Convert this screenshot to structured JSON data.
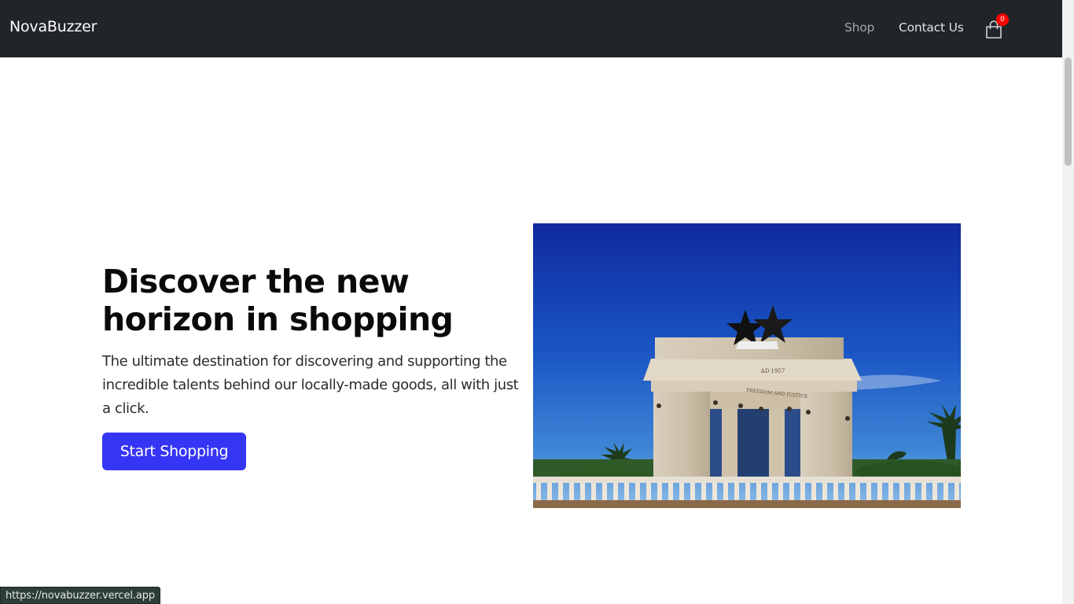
{
  "navbar": {
    "brand": "NovaBuzzer",
    "links": [
      {
        "label": "Shop"
      },
      {
        "label": "Contact Us"
      }
    ],
    "cart_count": "0",
    "cart_icon": "shopping-bag-icon"
  },
  "hero": {
    "title": "Discover the new horizon in shopping",
    "description": "The ultimate destination for discovering and supporting the incredible talents behind our locally-made goods, all with just a click.",
    "cta_label": "Start Shopping",
    "image_alt": "Independence Arch monument",
    "arch_inscription_top": "AD 1957",
    "arch_inscription_bottom": "FREEDOM AND JUSTICE"
  },
  "status_bar": {
    "url": "https://novabuzzer.vercel.app"
  },
  "colors": {
    "navbar_bg": "#212529",
    "cta_bg": "#3535f5",
    "badge_bg": "#ff0000"
  }
}
